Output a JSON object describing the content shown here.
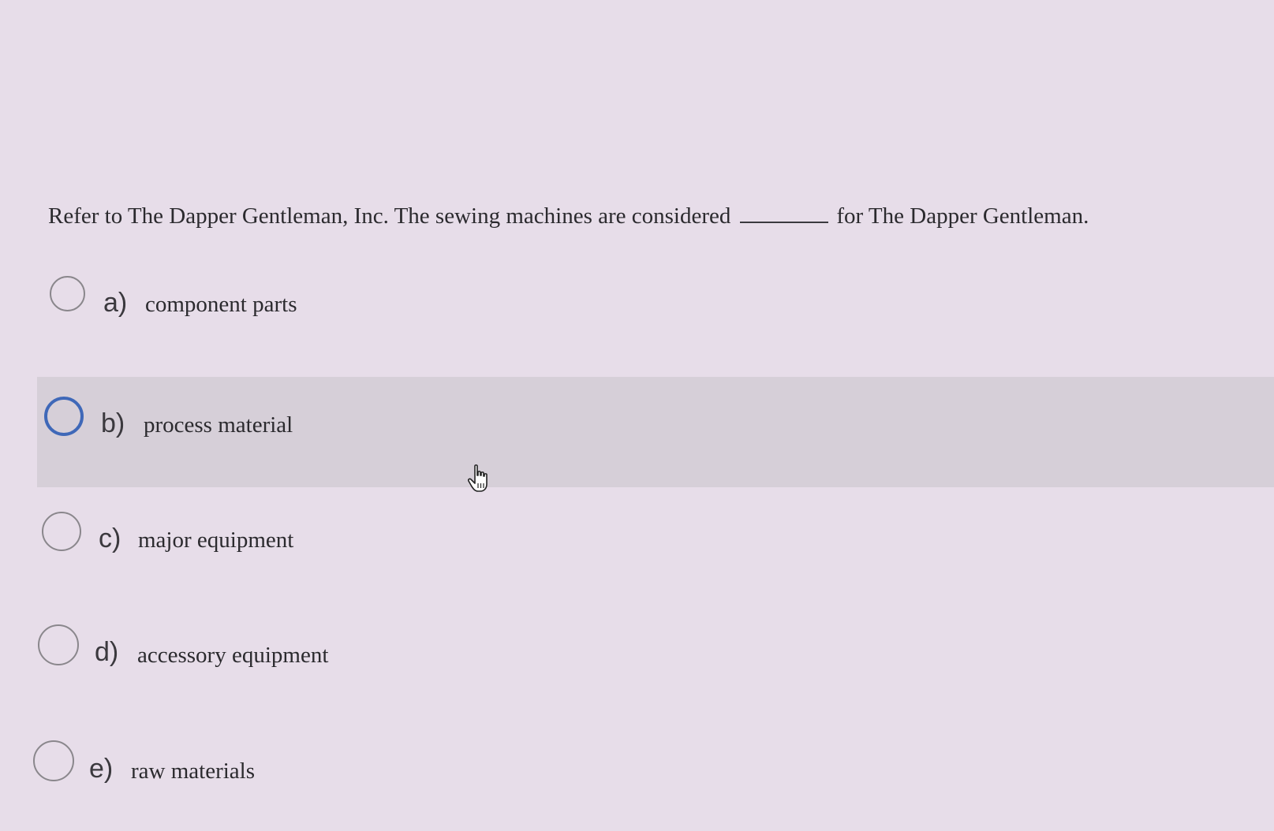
{
  "question": {
    "before_blank": "Refer to The Dapper Gentleman, Inc. The sewing machines are considered",
    "after_blank": "for The Dapper Gentleman."
  },
  "options": [
    {
      "letter": "a)",
      "text": "component parts",
      "selected": false,
      "highlighted": false
    },
    {
      "letter": "b)",
      "text": "process material",
      "selected": false,
      "highlighted": true
    },
    {
      "letter": "c)",
      "text": "major equipment",
      "selected": false,
      "highlighted": false
    },
    {
      "letter": "d)",
      "text": "accessory equipment",
      "selected": false,
      "highlighted": false
    },
    {
      "letter": "e)",
      "text": "raw materials",
      "selected": false,
      "highlighted": false
    }
  ],
  "colors": {
    "background": "#e7dde9",
    "highlight_row": "#d6cfd8",
    "focus_ring": "#3f68b8"
  },
  "cursor_icon": "hand-pointer-icon"
}
